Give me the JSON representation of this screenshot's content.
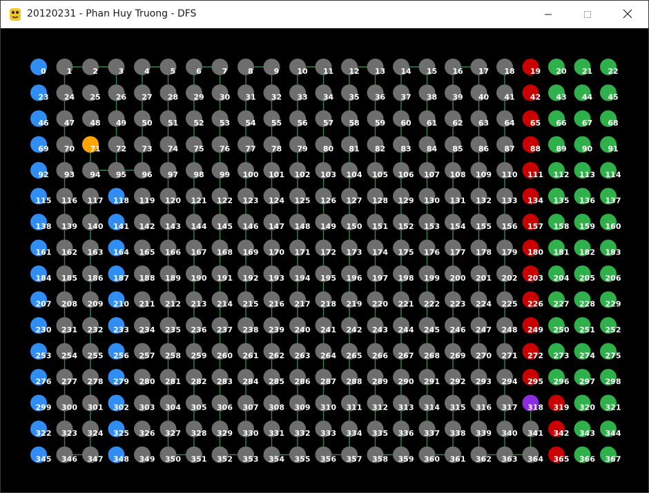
{
  "window": {
    "title": "20120231 - Phan Huy Truong - DFS",
    "app_icon": "python-icon",
    "controls": [
      "minimize-icon",
      "maximize-icon",
      "close-icon"
    ]
  },
  "grid": {
    "columns": 23,
    "rows": 16,
    "labels_start": 0,
    "labels_end": 367,
    "label_color": "#ffffff"
  },
  "colors": {
    "background": "#000000",
    "unvisited": "#6e6e6e",
    "start_column": "#2f8df4",
    "blocked": "#c80000",
    "goal_area": "#30b04a",
    "start": "#ffa500",
    "goal": "#8b2be2",
    "path": "#2e8b3f"
  },
  "special": {
    "start": 71,
    "goal": 318,
    "blue_nodes": [
      0,
      23,
      46,
      69,
      92,
      115,
      138,
      161,
      184,
      207,
      230,
      253,
      276,
      299,
      322,
      345,
      118,
      141,
      164,
      187,
      210,
      233,
      256,
      279,
      302,
      325,
      348
    ],
    "red_nodes": [
      19,
      42,
      65,
      88,
      111,
      134,
      157,
      180,
      203,
      226,
      249,
      272,
      295,
      319,
      342,
      365
    ],
    "green_nodes": [
      20,
      21,
      22,
      43,
      44,
      45,
      66,
      67,
      68,
      89,
      90,
      91,
      112,
      113,
      114,
      135,
      136,
      137,
      158,
      159,
      160,
      181,
      182,
      183,
      204,
      205,
      206,
      227,
      228,
      229,
      250,
      251,
      252,
      273,
      274,
      275,
      296,
      297,
      298,
      320,
      321,
      343,
      344,
      366,
      367
    ]
  },
  "path_edges": [
    [
      71,
      94
    ],
    [
      94,
      95
    ],
    [
      95,
      72
    ],
    [
      72,
      49
    ],
    [
      49,
      26
    ],
    [
      26,
      3
    ],
    [
      3,
      2
    ],
    [
      2,
      1
    ],
    [
      1,
      24
    ],
    [
      24,
      47
    ],
    [
      47,
      70
    ],
    [
      70,
      93
    ],
    [
      93,
      116
    ],
    [
      116,
      139
    ],
    [
      139,
      162
    ],
    [
      162,
      185
    ],
    [
      185,
      208
    ],
    [
      208,
      231
    ],
    [
      231,
      254
    ],
    [
      254,
      277
    ],
    [
      277,
      300
    ],
    [
      300,
      323
    ],
    [
      323,
      346
    ],
    [
      346,
      347
    ],
    [
      347,
      324
    ],
    [
      324,
      301
    ],
    [
      301,
      278
    ],
    [
      278,
      255
    ],
    [
      255,
      232
    ],
    [
      232,
      209
    ],
    [
      209,
      186
    ],
    [
      186,
      163
    ],
    [
      163,
      140
    ],
    [
      140,
      117
    ],
    [
      95,
      96
    ],
    [
      96,
      73
    ],
    [
      73,
      50
    ],
    [
      50,
      27
    ],
    [
      27,
      4
    ],
    [
      4,
      5
    ],
    [
      5,
      28
    ],
    [
      28,
      51
    ],
    [
      51,
      74
    ],
    [
      74,
      97
    ],
    [
      97,
      120
    ],
    [
      120,
      143
    ],
    [
      143,
      166
    ],
    [
      166,
      189
    ],
    [
      189,
      212
    ],
    [
      212,
      235
    ],
    [
      235,
      258
    ],
    [
      258,
      281
    ],
    [
      281,
      304
    ],
    [
      304,
      327
    ],
    [
      327,
      350
    ],
    [
      350,
      351
    ],
    [
      351,
      328
    ],
    [
      328,
      305
    ],
    [
      305,
      282
    ],
    [
      282,
      259
    ],
    [
      259,
      236
    ],
    [
      236,
      213
    ],
    [
      213,
      190
    ],
    [
      190,
      167
    ],
    [
      167,
      144
    ],
    [
      144,
      121
    ],
    [
      121,
      98
    ],
    [
      98,
      75
    ],
    [
      75,
      52
    ],
    [
      52,
      29
    ],
    [
      29,
      6
    ],
    [
      6,
      7
    ],
    [
      7,
      30
    ],
    [
      30,
      53
    ],
    [
      53,
      76
    ],
    [
      76,
      99
    ],
    [
      99,
      122
    ],
    [
      122,
      145
    ],
    [
      145,
      168
    ],
    [
      168,
      191
    ],
    [
      191,
      214
    ],
    [
      214,
      237
    ],
    [
      237,
      260
    ],
    [
      260,
      283
    ],
    [
      283,
      306
    ],
    [
      306,
      329
    ],
    [
      329,
      352
    ],
    [
      352,
      353
    ],
    [
      353,
      330
    ],
    [
      330,
      307
    ],
    [
      307,
      284
    ],
    [
      284,
      261
    ],
    [
      261,
      238
    ],
    [
      238,
      215
    ],
    [
      215,
      192
    ],
    [
      192,
      169
    ],
    [
      169,
      146
    ],
    [
      146,
      123
    ],
    [
      123,
      100
    ],
    [
      100,
      77
    ],
    [
      77,
      54
    ],
    [
      54,
      31
    ],
    [
      31,
      8
    ],
    [
      8,
      9
    ],
    [
      9,
      32
    ],
    [
      32,
      55
    ],
    [
      55,
      78
    ],
    [
      78,
      101
    ],
    [
      101,
      124
    ],
    [
      124,
      147
    ],
    [
      147,
      170
    ],
    [
      170,
      193
    ],
    [
      193,
      216
    ],
    [
      216,
      239
    ],
    [
      239,
      262
    ],
    [
      262,
      285
    ],
    [
      285,
      308
    ],
    [
      308,
      331
    ],
    [
      331,
      354
    ],
    [
      354,
      355
    ],
    [
      355,
      332
    ],
    [
      332,
      309
    ],
    [
      309,
      286
    ],
    [
      286,
      263
    ],
    [
      263,
      240
    ],
    [
      240,
      217
    ],
    [
      217,
      194
    ],
    [
      194,
      171
    ],
    [
      171,
      148
    ],
    [
      148,
      125
    ],
    [
      125,
      102
    ],
    [
      102,
      79
    ],
    [
      79,
      56
    ],
    [
      56,
      33
    ],
    [
      33,
      10
    ],
    [
      10,
      11
    ],
    [
      11,
      34
    ],
    [
      34,
      57
    ],
    [
      57,
      80
    ],
    [
      80,
      103
    ],
    [
      103,
      126
    ],
    [
      126,
      149
    ],
    [
      149,
      172
    ],
    [
      172,
      195
    ],
    [
      195,
      218
    ],
    [
      218,
      241
    ],
    [
      241,
      264
    ],
    [
      264,
      287
    ],
    [
      287,
      310
    ],
    [
      310,
      333
    ],
    [
      333,
      356
    ],
    [
      356,
      357
    ],
    [
      357,
      334
    ],
    [
      334,
      311
    ],
    [
      311,
      288
    ],
    [
      288,
      265
    ],
    [
      265,
      242
    ],
    [
      242,
      219
    ],
    [
      219,
      196
    ],
    [
      196,
      173
    ],
    [
      173,
      150
    ],
    [
      150,
      127
    ],
    [
      127,
      104
    ],
    [
      104,
      81
    ],
    [
      81,
      58
    ],
    [
      58,
      35
    ],
    [
      35,
      12
    ],
    [
      12,
      13
    ],
    [
      13,
      36
    ],
    [
      36,
      59
    ],
    [
      59,
      82
    ],
    [
      82,
      105
    ],
    [
      105,
      128
    ],
    [
      128,
      151
    ],
    [
      151,
      174
    ],
    [
      174,
      197
    ],
    [
      197,
      220
    ],
    [
      220,
      243
    ],
    [
      243,
      266
    ],
    [
      266,
      289
    ],
    [
      289,
      312
    ],
    [
      312,
      335
    ],
    [
      335,
      358
    ],
    [
      358,
      359
    ],
    [
      359,
      336
    ],
    [
      336,
      313
    ],
    [
      313,
      290
    ],
    [
      290,
      267
    ],
    [
      267,
      244
    ],
    [
      244,
      221
    ],
    [
      221,
      198
    ],
    [
      198,
      175
    ],
    [
      175,
      152
    ],
    [
      152,
      129
    ],
    [
      129,
      106
    ],
    [
      106,
      83
    ],
    [
      83,
      60
    ],
    [
      60,
      37
    ],
    [
      37,
      14
    ],
    [
      14,
      15
    ],
    [
      15,
      38
    ],
    [
      38,
      61
    ],
    [
      61,
      84
    ],
    [
      84,
      107
    ],
    [
      107,
      130
    ],
    [
      130,
      153
    ],
    [
      153,
      176
    ],
    [
      176,
      199
    ],
    [
      199,
      222
    ],
    [
      222,
      245
    ],
    [
      245,
      268
    ],
    [
      268,
      291
    ],
    [
      291,
      314
    ],
    [
      314,
      337
    ],
    [
      337,
      360
    ],
    [
      360,
      361
    ],
    [
      361,
      338
    ],
    [
      338,
      315
    ],
    [
      315,
      292
    ],
    [
      292,
      269
    ],
    [
      269,
      246
    ],
    [
      246,
      223
    ],
    [
      223,
      200
    ],
    [
      200,
      177
    ],
    [
      177,
      154
    ],
    [
      154,
      131
    ],
    [
      131,
      108
    ],
    [
      108,
      85
    ],
    [
      85,
      62
    ],
    [
      62,
      39
    ],
    [
      39,
      16
    ],
    [
      16,
      17
    ],
    [
      17,
      40
    ],
    [
      40,
      63
    ],
    [
      63,
      86
    ],
    [
      86,
      109
    ],
    [
      109,
      132
    ],
    [
      132,
      155
    ],
    [
      155,
      178
    ],
    [
      178,
      201
    ],
    [
      201,
      224
    ],
    [
      224,
      247
    ],
    [
      247,
      270
    ],
    [
      270,
      293
    ],
    [
      293,
      316
    ],
    [
      316,
      339
    ],
    [
      339,
      362
    ],
    [
      362,
      363
    ],
    [
      363,
      340
    ],
    [
      340,
      317
    ],
    [
      317,
      294
    ],
    [
      294,
      271
    ],
    [
      271,
      248
    ],
    [
      248,
      225
    ],
    [
      225,
      202
    ],
    [
      202,
      179
    ],
    [
      179,
      156
    ],
    [
      156,
      133
    ],
    [
      133,
      110
    ],
    [
      110,
      87
    ],
    [
      87,
      64
    ],
    [
      64,
      41
    ],
    [
      41,
      18
    ],
    [
      363,
      364
    ],
    [
      364,
      341
    ],
    [
      341,
      318
    ]
  ]
}
